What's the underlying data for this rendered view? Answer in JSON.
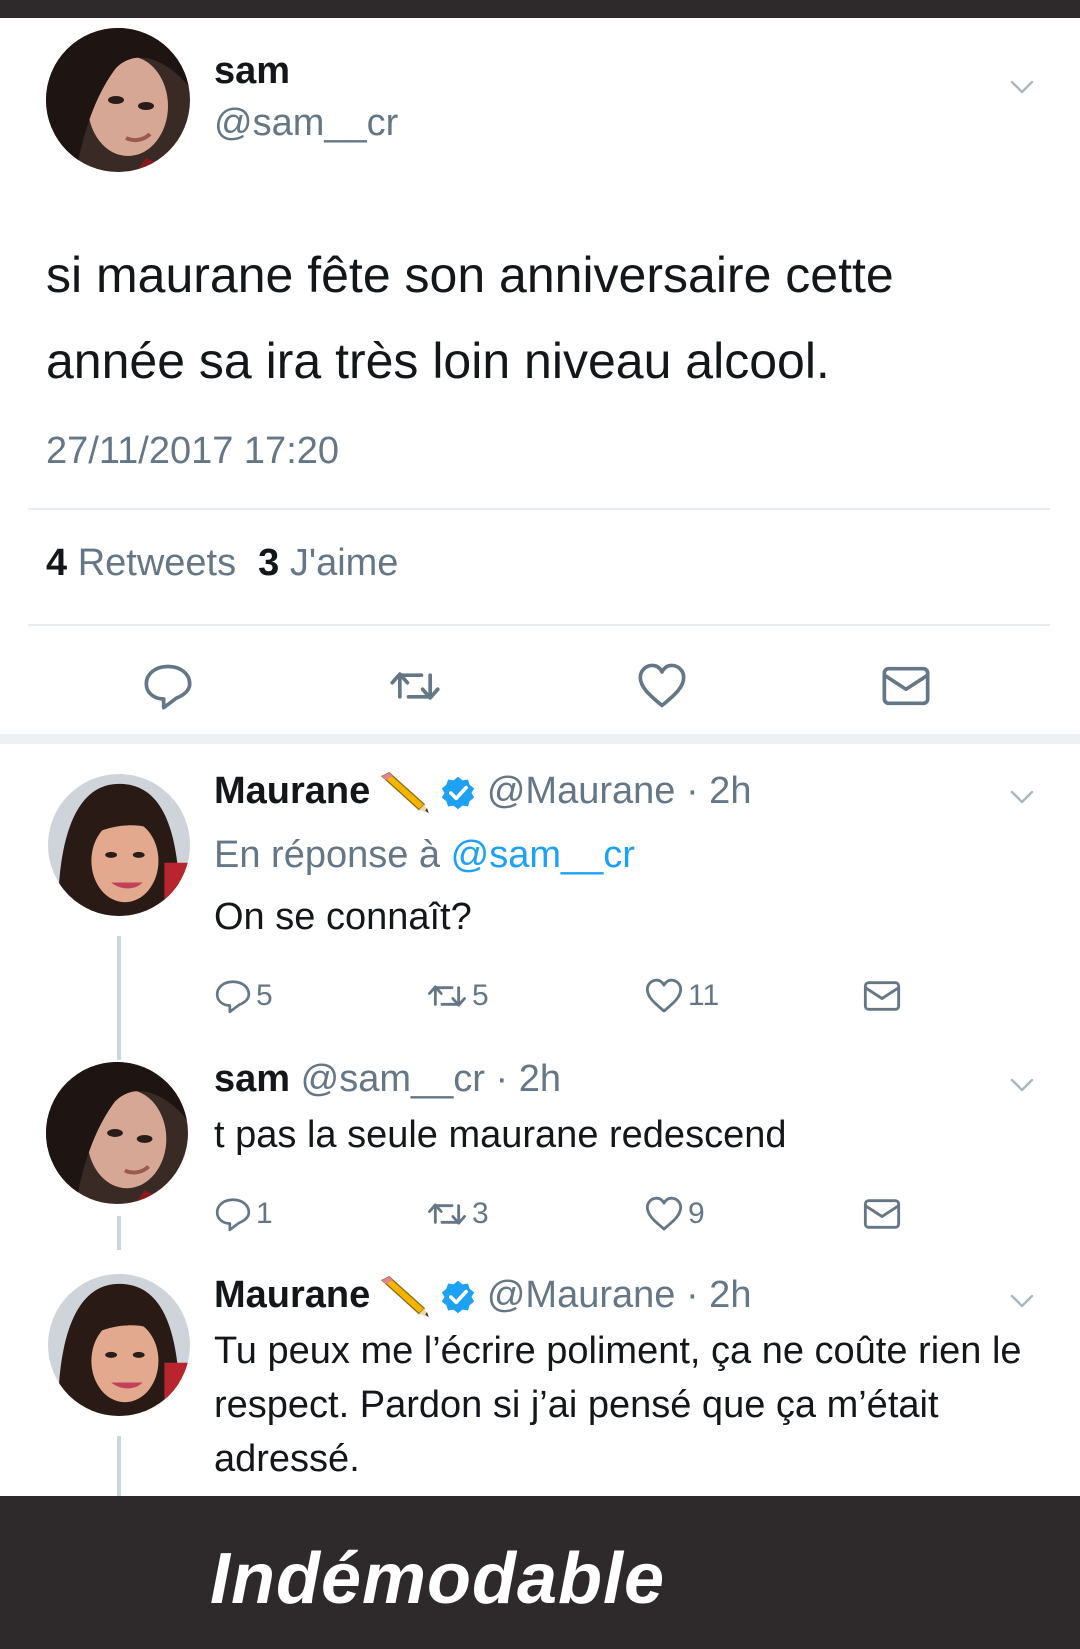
{
  "main_tweet": {
    "author_name": "sam",
    "author_handle": "@sam__cr",
    "text": "si maurane fête son anniversaire cette année sa ira très loin niveau alcool.",
    "timestamp": "27/11/2017 17:20",
    "retweets_count": "4",
    "retweets_label": "Retweets",
    "likes_count": "3",
    "likes_label": "J'aime",
    "icons": [
      "reply-icon",
      "retweet-icon",
      "like-icon",
      "dm-icon"
    ]
  },
  "replies": [
    {
      "author_name": "Maurane",
      "author_emoji": "✏️",
      "verified": true,
      "author_handle": "@Maurane",
      "time": "· 2h",
      "reply_prefix": "En réponse à",
      "reply_mention": "@sam__cr",
      "text": "On se connaît?",
      "reply_count": "5",
      "retweet_count": "5",
      "like_count": "11"
    },
    {
      "author_name": "sam",
      "verified": false,
      "author_handle": "@sam__cr",
      "time": "· 2h",
      "text": "t pas la seule maurane redescend",
      "reply_count": "1",
      "retweet_count": "3",
      "like_count": "9"
    },
    {
      "author_name": "Maurane",
      "author_emoji": "✏️",
      "verified": true,
      "author_handle": "@Maurane",
      "time": "· 2h",
      "text": "Tu peux me l’écrire poliment, ça ne coûte rien le respect. Pardon si j’ai pensé que ça m’était adressé."
    }
  ],
  "caption": "Indémodable",
  "colors": {
    "bar": "#2e2a2b",
    "link_blue": "#1da1f2",
    "muted_gray": "#657786",
    "text": "#14171a"
  }
}
